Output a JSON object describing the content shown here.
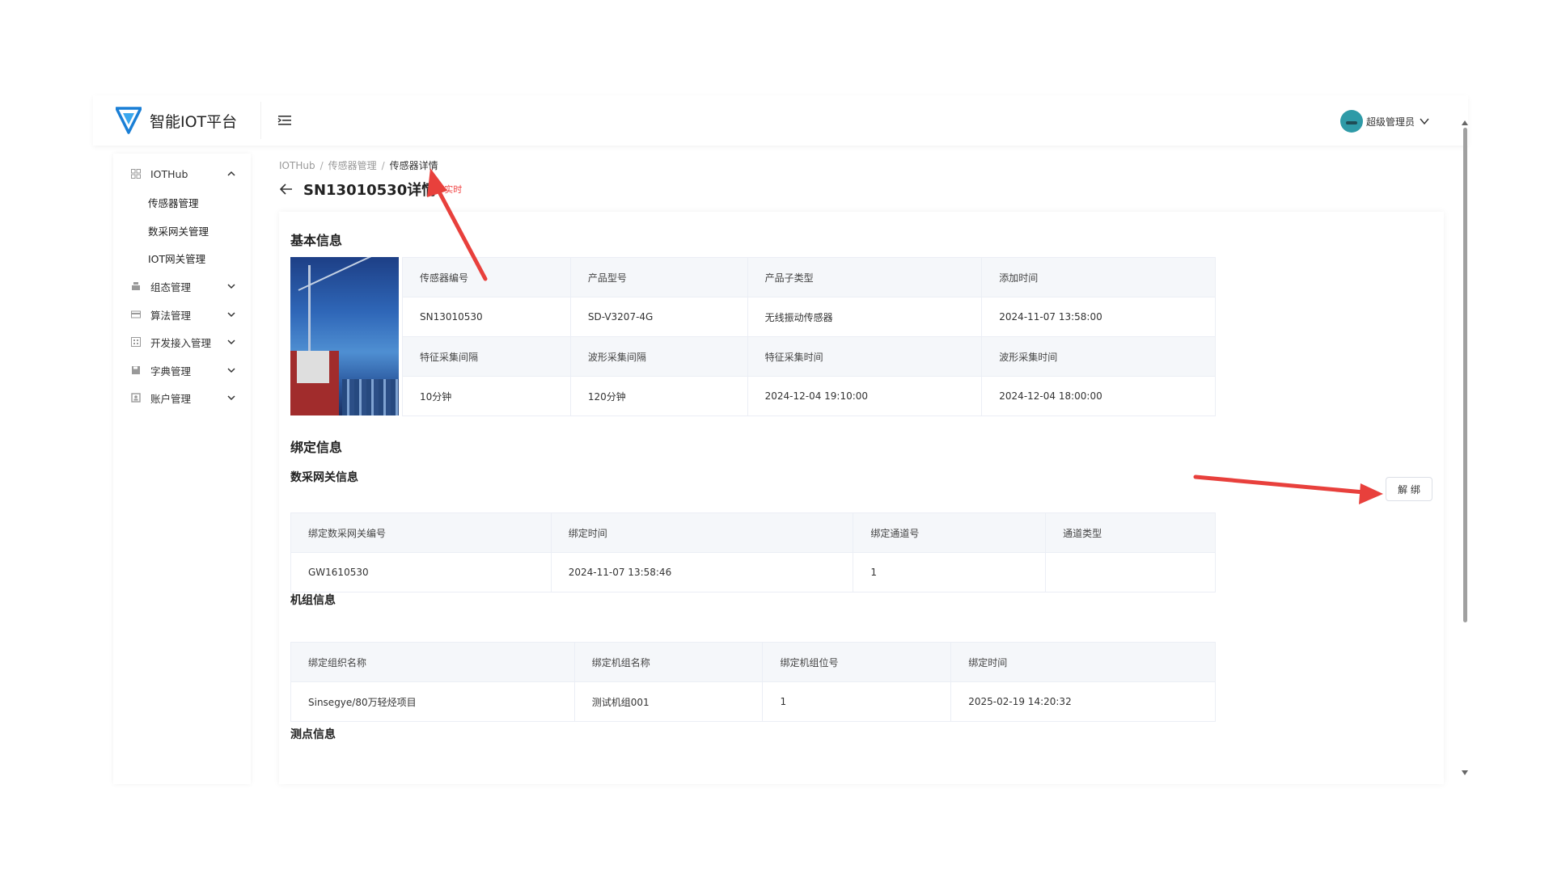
{
  "header": {
    "app_name": "智能IOT平台",
    "user_name": "超级管理员"
  },
  "sidebar": {
    "items": [
      {
        "label": "IOTHub",
        "icon": "grid-icon",
        "expanded": true
      },
      {
        "label": "组态管理",
        "icon": "layers-icon"
      },
      {
        "label": "算法管理",
        "icon": "card-icon"
      },
      {
        "label": "开发接入管理",
        "icon": "apps-icon"
      },
      {
        "label": "字典管理",
        "icon": "save-icon"
      },
      {
        "label": "账户管理",
        "icon": "account-icon"
      }
    ],
    "iothub_children": [
      "传感器管理",
      "数采网关管理",
      "IOT网关管理"
    ]
  },
  "breadcrumb": [
    "IOTHub",
    "传感器管理",
    "传感器详情"
  ],
  "page": {
    "title": "SN13010530详情",
    "tag": "实时"
  },
  "basic_info": {
    "title": "基本信息",
    "headers_row1": [
      "传感器编号",
      "产品型号",
      "产品子类型",
      "添加时间"
    ],
    "values_row1": [
      "SN13010530",
      "SD-V3207-4G",
      "无线振动传感器",
      "2024-11-07 13:58:00"
    ],
    "headers_row2": [
      "特征采集间隔",
      "波形采集间隔",
      "特征采集时间",
      "波形采集时间"
    ],
    "values_row2": [
      "10分钟",
      "120分钟",
      "2024-12-04 19:10:00",
      "2024-12-04 18:00:00"
    ]
  },
  "binding": {
    "title": "绑定信息",
    "unbind_label": "解 绑",
    "gateway": {
      "title": "数采网关信息",
      "headers": [
        "绑定数采网关编号",
        "绑定时间",
        "绑定通道号",
        "通道类型"
      ],
      "row": [
        "GW1610530",
        "2024-11-07 13:58:46",
        "1",
        ""
      ]
    },
    "unit": {
      "title": "机组信息",
      "headers": [
        "绑定组织名称",
        "绑定机组名称",
        "绑定机组位号",
        "绑定时间"
      ],
      "row": [
        "Sinsegye/80万轻烃项目",
        "测试机组001",
        "1",
        "2025-02-19 14:20:32"
      ]
    },
    "point_title": "测点信息"
  },
  "colors": {
    "annotation_red": "#e8403c",
    "brand_blue": "#1a7fd6"
  }
}
